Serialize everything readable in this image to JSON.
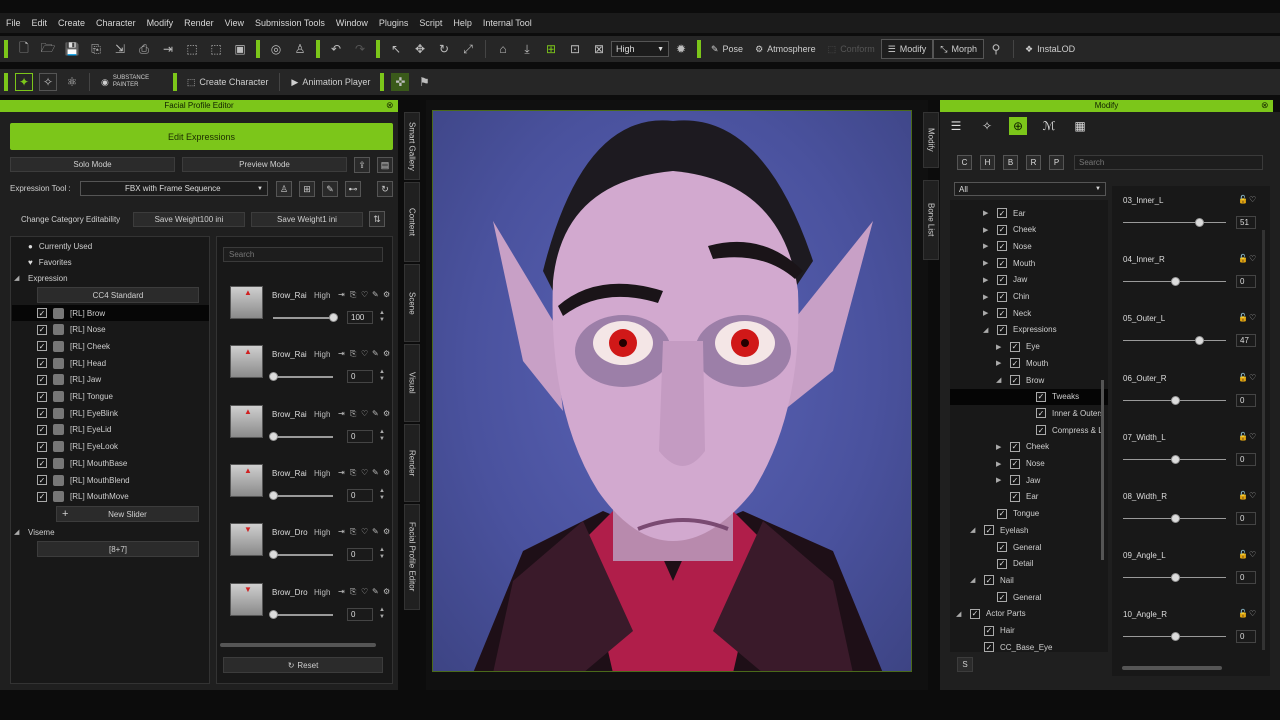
{
  "menu": [
    "File",
    "Edit",
    "Create",
    "Character",
    "Modify",
    "Render",
    "View",
    "Submission Tools",
    "Window",
    "Plugins",
    "Script",
    "Help",
    "Internal Tool"
  ],
  "toolbar1": {
    "quality": "High",
    "pose": "Pose",
    "atmosphere": "Atmosphere",
    "conform": "Conform",
    "modify": "Modify",
    "morph": "Morph",
    "instalod": "InstaLOD"
  },
  "toolbar2": {
    "substance": "SUBSTANCE PAINTER",
    "create_character": "Create Character",
    "animation_player": "Animation Player"
  },
  "fpe": {
    "title": "Facial Profile Editor",
    "edit_expressions": "Edit Expressions",
    "solo_mode": "Solo Mode",
    "preview_mode": "Preview Mode",
    "expression_tool_label": "Expression Tool :",
    "expression_tool_value": "FBX with Frame Sequence",
    "change_category": "Change Category Editability",
    "save_weight100": "Save Weight100 ini",
    "save_weight1": "Save Weight1 ini",
    "tree": {
      "currently_used": "Currently Used",
      "favorites": "Favorites",
      "expression": "Expression",
      "cc4_standard": "CC4 Standard",
      "items": [
        "[RL] Brow",
        "[RL] Nose",
        "[RL] Cheek",
        "[RL] Head",
        "[RL] Jaw",
        "[RL] Tongue",
        "[RL] EyeBlink",
        "[RL] EyeLid",
        "[RL] EyeLook",
        "[RL] MouthBase",
        "[RL] MouthBlend",
        "[RL] MouthMove"
      ],
      "new_slider": "New Slider",
      "viseme": "Viseme",
      "viseme_value": "[8+7]"
    },
    "search_placeholder": "Search",
    "sliders": [
      {
        "name": "Brow_Rai",
        "quality": "High",
        "value": "100",
        "fraction": 1.0
      },
      {
        "name": "Brow_Rai",
        "quality": "High",
        "value": "0",
        "fraction": 0
      },
      {
        "name": "Brow_Rai",
        "quality": "High",
        "value": "0",
        "fraction": 0
      },
      {
        "name": "Brow_Rai",
        "quality": "High",
        "value": "0",
        "fraction": 0
      },
      {
        "name": "Brow_Dro",
        "quality": "High",
        "value": "0",
        "fraction": 0
      },
      {
        "name": "Brow_Dro",
        "quality": "High",
        "value": "0",
        "fraction": 0
      }
    ],
    "reset": "Reset"
  },
  "vtabs_left": [
    "Smart Gallery",
    "Content",
    "Scene",
    "Visual",
    "Render",
    "Facial Profile Editor"
  ],
  "vtabs_right": [
    "Modify",
    "Bone List"
  ],
  "modify": {
    "title": "Modify",
    "filters": [
      "C",
      "H",
      "B",
      "R",
      "P"
    ],
    "search_placeholder": "Search",
    "all": "All",
    "tree": [
      {
        "label": "Ear",
        "level": 2,
        "arrow": "▶"
      },
      {
        "label": "Cheek",
        "level": 2,
        "arrow": "▶"
      },
      {
        "label": "Nose",
        "level": 2,
        "arrow": "▶"
      },
      {
        "label": "Mouth",
        "level": 2,
        "arrow": "▶"
      },
      {
        "label": "Jaw",
        "level": 2,
        "arrow": "▶"
      },
      {
        "label": "Chin",
        "level": 2,
        "arrow": "▶"
      },
      {
        "label": "Neck",
        "level": 2,
        "arrow": "▶"
      },
      {
        "label": "Expressions",
        "level": 2,
        "arrow": "◢"
      },
      {
        "label": "Eye",
        "level": 3,
        "arrow": "▶"
      },
      {
        "label": "Mouth",
        "level": 3,
        "arrow": "▶"
      },
      {
        "label": "Brow",
        "level": 3,
        "arrow": "◢"
      },
      {
        "label": "Tweaks",
        "level": 4,
        "arrow": ""
      },
      {
        "label": "Inner & Outers",
        "level": 4,
        "arrow": ""
      },
      {
        "label": "Compress & L",
        "level": 4,
        "arrow": ""
      },
      {
        "label": "Cheek",
        "level": 3,
        "arrow": "▶"
      },
      {
        "label": "Nose",
        "level": 3,
        "arrow": "▶"
      },
      {
        "label": "Jaw",
        "level": 3,
        "arrow": "▶"
      },
      {
        "label": "Ear",
        "level": 3,
        "arrow": ""
      },
      {
        "label": "Tongue",
        "level": 2,
        "arrow": ""
      },
      {
        "label": "Eyelash",
        "level": 1,
        "arrow": "◢"
      },
      {
        "label": "General",
        "level": 2,
        "arrow": ""
      },
      {
        "label": "Detail",
        "level": 2,
        "arrow": ""
      },
      {
        "label": "Nail",
        "level": 1,
        "arrow": "◢"
      },
      {
        "label": "General",
        "level": 2,
        "arrow": ""
      },
      {
        "label": "Actor Parts",
        "level": 0,
        "arrow": "◢"
      },
      {
        "label": "Hair",
        "level": 1,
        "arrow": ""
      },
      {
        "label": "CC_Base_Eye",
        "level": 1,
        "arrow": ""
      }
    ],
    "sliders": [
      {
        "name": "03_Inner_L",
        "value": "51",
        "fraction": 0.74
      },
      {
        "name": "04_Inner_R",
        "value": "0",
        "fraction": 0.5
      },
      {
        "name": "05_Outer_L",
        "value": "47",
        "fraction": 0.74
      },
      {
        "name": "06_Outer_R",
        "value": "0",
        "fraction": 0.5
      },
      {
        "name": "07_Width_L",
        "value": "0",
        "fraction": 0.5
      },
      {
        "name": "08_Width_R",
        "value": "0",
        "fraction": 0.5
      },
      {
        "name": "09_Angle_L",
        "value": "0",
        "fraction": 0.5
      },
      {
        "name": "10_Angle_R",
        "value": "0",
        "fraction": 0.5
      }
    ],
    "s_button": "S"
  }
}
